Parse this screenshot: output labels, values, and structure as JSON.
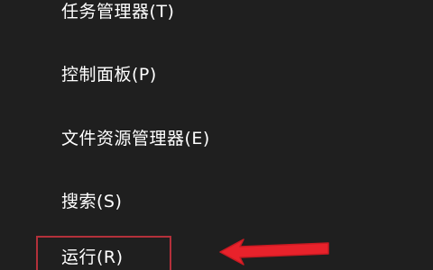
{
  "context_menu": {
    "items": [
      {
        "label": "任务管理器(T)"
      },
      {
        "label": "控制面板(P)"
      },
      {
        "label": "文件资源管理器(E)"
      },
      {
        "label": "搜索(S)"
      },
      {
        "label": "运行(R)"
      }
    ],
    "highlighted_item": "运行(R)"
  },
  "annotation": {
    "arrow_icon": "red-arrow-icon",
    "highlight_color": "#b3303a",
    "arrow_color": "#e8222b"
  }
}
